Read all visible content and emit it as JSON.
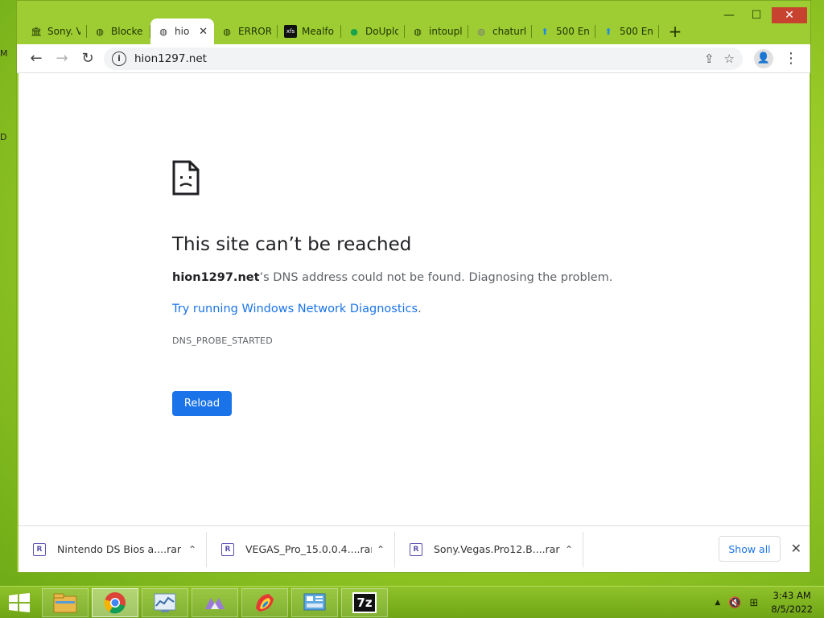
{
  "desktop": {
    "peek_top": "M",
    "peek_mid": "D"
  },
  "window": {
    "minimize_glyph": "—",
    "maximize_glyph": "☐",
    "close_glyph": "✕"
  },
  "tabs": [
    {
      "label": "Sony. V",
      "icon": "bank-icon",
      "glyph": "🏛"
    },
    {
      "label": "Blocke",
      "icon": "globe-icon",
      "glyph": "◍"
    },
    {
      "label": "hio",
      "icon": "globe-icon",
      "glyph": "◍",
      "active": true
    },
    {
      "label": "ERROR",
      "icon": "globe-icon",
      "glyph": "◍"
    },
    {
      "label": "Mealfo",
      "icon": "xfs-icon",
      "glyph": "xfs"
    },
    {
      "label": "DoUplo",
      "icon": "leaf-icon",
      "glyph": "●"
    },
    {
      "label": "intoupl",
      "icon": "globe-icon",
      "glyph": "◍"
    },
    {
      "label": "chaturl",
      "icon": "globe-icon",
      "glyph": "◍"
    },
    {
      "label": "500 En",
      "icon": "cloud-upload-icon",
      "glyph": "⬆"
    },
    {
      "label": "500 En",
      "icon": "cloud-upload-icon",
      "glyph": "⬆"
    }
  ],
  "tab_close": "✕",
  "new_tab": "+",
  "toolbar": {
    "back": "←",
    "forward": "→",
    "reload": "↻",
    "info": "i",
    "url": "hion1297.net",
    "share": "⇪",
    "star": "☆",
    "profile": "👤",
    "menu": "⋮"
  },
  "error": {
    "title": "This site can’t be reached",
    "host": "hion1297.net",
    "desc_rest": "’s DNS address could not be found. Diagnosing the problem.",
    "link": "Try running Windows Network Diagnostics",
    "link_dot": ".",
    "code": "DNS_PROBE_STARTED",
    "reload": "Reload"
  },
  "downloads": [
    {
      "name": "Nintendo DS Bios a....rar",
      "icon": "rar-icon"
    },
    {
      "name": "VEGAS_Pro_15.0.0.4....rar",
      "icon": "rar-icon"
    },
    {
      "name": "Sony.Vegas.Pro12.B....rar",
      "icon": "rar-icon"
    }
  ],
  "dl_caret": "⌃",
  "dl_icon_glyph": "R",
  "show_all": "Show all",
  "shelf_close": "✕",
  "taskbar": {
    "apps": [
      {
        "name": "file-explorer"
      },
      {
        "name": "chrome",
        "active": true
      },
      {
        "name": "system-monitor"
      },
      {
        "name": "media-app"
      },
      {
        "name": "paint-app"
      },
      {
        "name": "control-panel"
      },
      {
        "name": "7zip",
        "label": "7z"
      }
    ],
    "tray_up": "▲",
    "tray_volume": "🔇",
    "tray_network": "⊞",
    "time": "3:43 AM",
    "date": "8/5/2022"
  },
  "colors": {
    "accent": "#1a73e8",
    "frame": "#9dcd33"
  }
}
